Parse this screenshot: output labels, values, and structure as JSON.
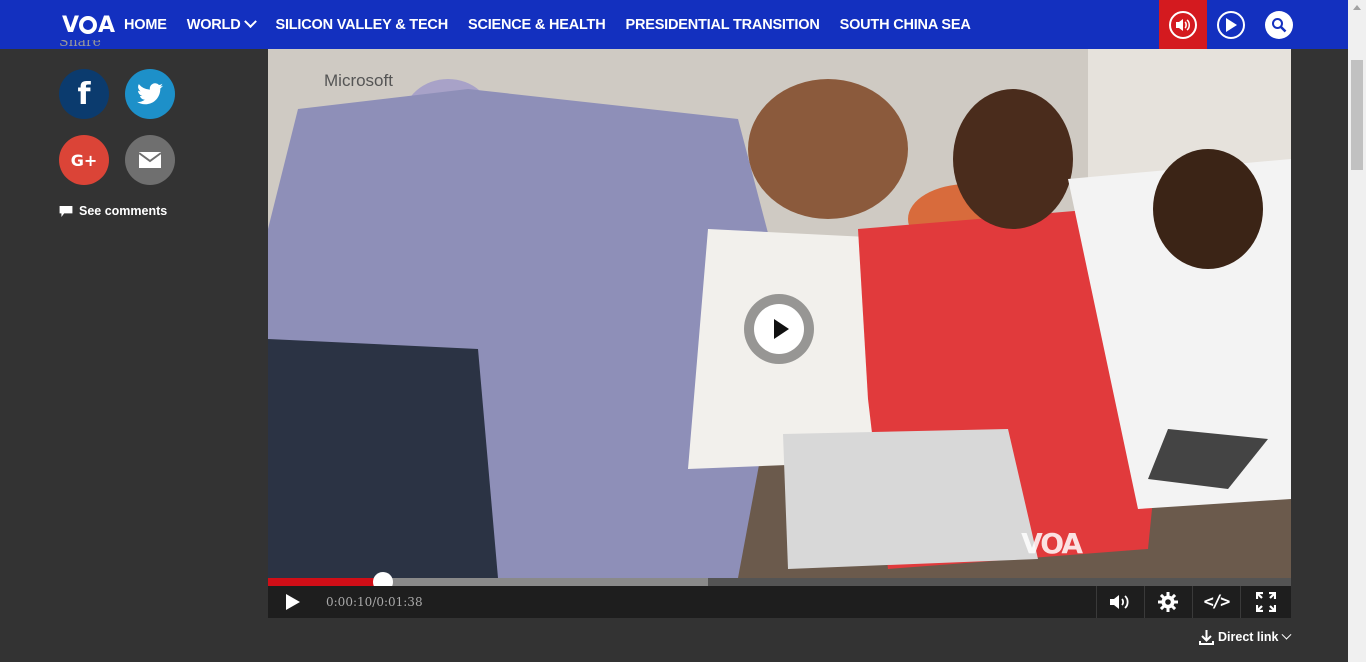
{
  "nav": {
    "logo": "VOA",
    "items": [
      {
        "label": "HOME"
      },
      {
        "label": "WORLD",
        "has_dropdown": true
      },
      {
        "label": "SILICON VALLEY & TECH"
      },
      {
        "label": "SCIENCE & HEALTH"
      },
      {
        "label": "PRESIDENTIAL TRANSITION"
      },
      {
        "label": "SOUTH CHINA SEA"
      }
    ],
    "icons": [
      "audio-icon",
      "video-icon",
      "search-icon"
    ],
    "colors": {
      "bar": "#1330bf",
      "audio_active": "#d41a1f"
    }
  },
  "share": {
    "label": "Share",
    "buttons": [
      "facebook",
      "twitter",
      "google-plus",
      "email"
    ],
    "comments_label": "See comments"
  },
  "video": {
    "watermark": "Microsoft",
    "corner_logo": "VOA",
    "current_time": "0:00:10",
    "duration": "0:01:38",
    "played_fraction": 0.112,
    "buffered_fraction": 0.43
  },
  "direct_link": {
    "label": "Direct link"
  }
}
